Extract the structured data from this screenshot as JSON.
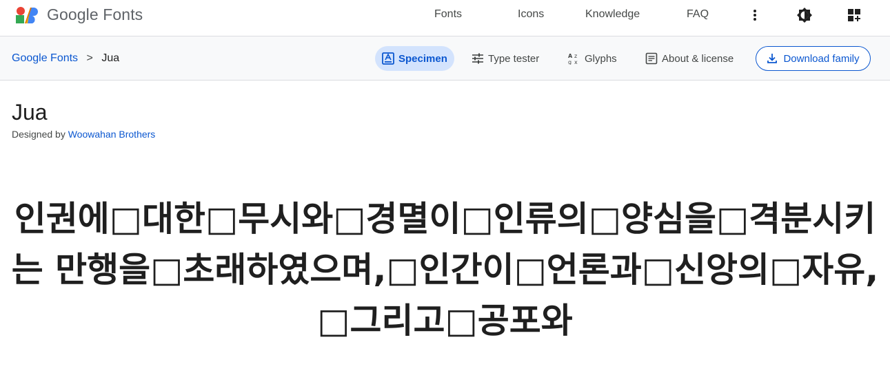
{
  "header": {
    "brand": "Google Fonts",
    "nav": [
      "Fonts",
      "Icons",
      "Knowledge",
      "FAQ"
    ],
    "icons": [
      "more-vert-icon",
      "theme-toggle-icon",
      "apps-add-icon"
    ]
  },
  "breadcrumb": {
    "root": "Google Fonts",
    "separator": ">",
    "current": "Jua"
  },
  "tabs": [
    {
      "label": "Specimen",
      "icon": "specimen-icon",
      "active": true
    },
    {
      "label": "Type tester",
      "icon": "tune-icon",
      "active": false
    },
    {
      "label": "Glyphs",
      "icon": "glyphs-icon",
      "active": false
    },
    {
      "label": "About & license",
      "icon": "article-icon",
      "active": false
    }
  ],
  "download": {
    "label": "Download family",
    "icon": "download-icon"
  },
  "font": {
    "name": "Jua",
    "designed_by_prefix": "Designed by",
    "designer": "Woowahan Brothers"
  },
  "specimen": {
    "text": "인권에□대한□무시와□경멸이□인류의□양심을□격분시키는 만행을□초래하였으며,□인간이□언론과□신앙의□자유,□그리고□공포와"
  },
  "colors": {
    "accent": "#0b57d0",
    "active_tab_bg": "#d3e3fd",
    "subbar_bg": "#f8f9fa",
    "text": "#1f1f1f",
    "muted": "#444746"
  }
}
